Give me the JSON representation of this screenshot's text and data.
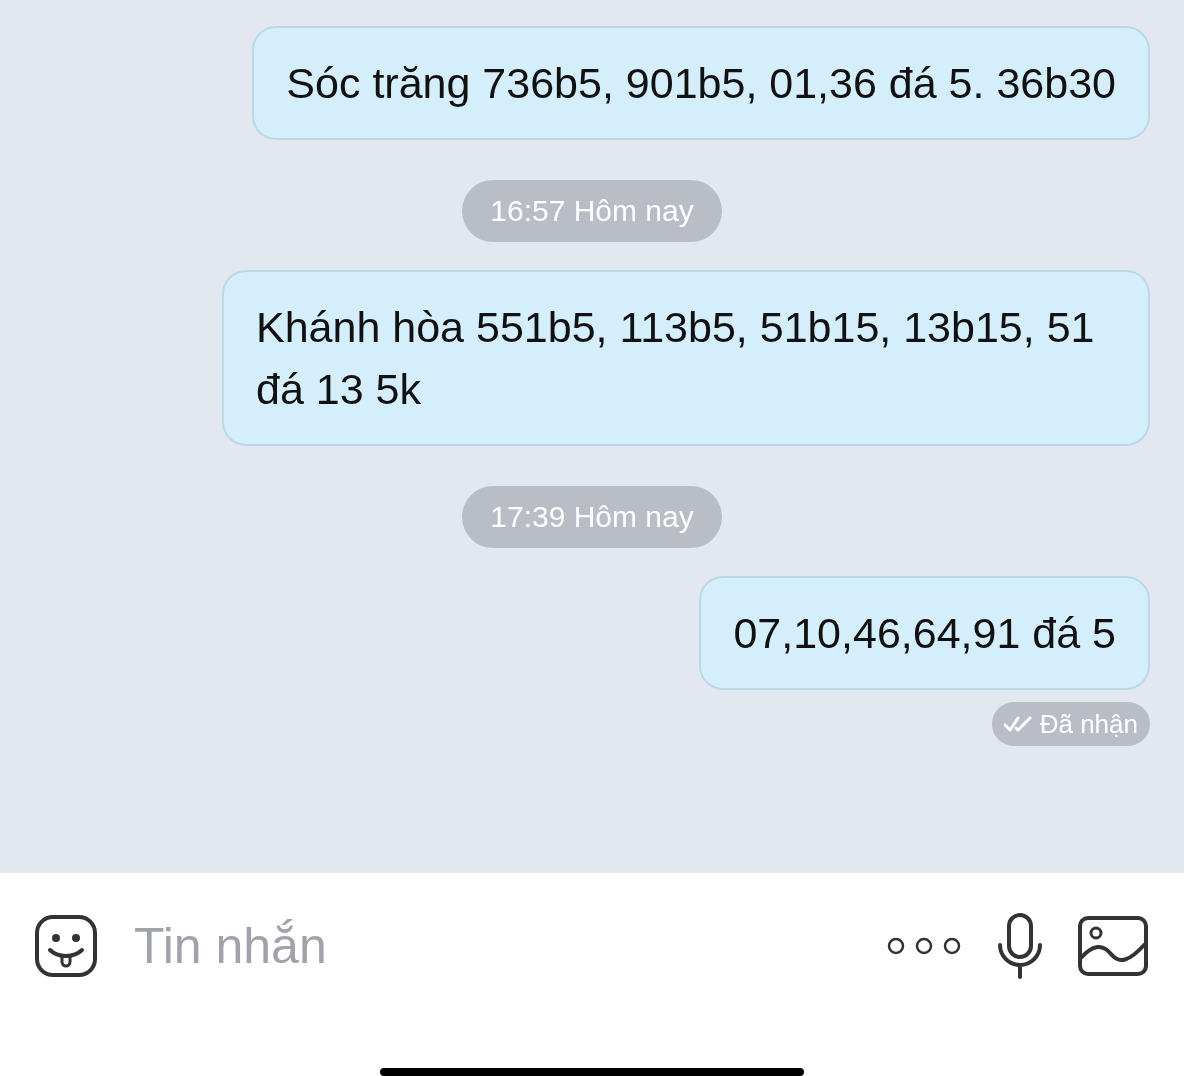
{
  "messages": [
    {
      "kind": "message",
      "text": "Sóc trăng 736b5, 901b5, 01,36 đá 5. 36b30"
    },
    {
      "kind": "time",
      "text": "16:57 Hôm nay"
    },
    {
      "kind": "message",
      "text": "Khánh hòa 551b5, 113b5, 51b15, 13b15, 51 đá 13 5k"
    },
    {
      "kind": "time",
      "text": "17:39 Hôm nay"
    },
    {
      "kind": "message",
      "text": "07,10,46,64,91 đá 5"
    },
    {
      "kind": "status",
      "text": "Đã nhận"
    }
  ],
  "composer": {
    "placeholder": "Tin nhắn"
  }
}
